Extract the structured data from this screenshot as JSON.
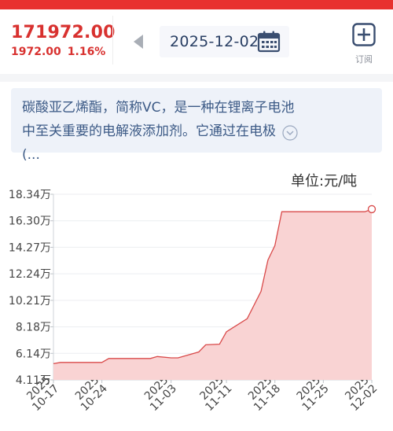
{
  "header": {
    "price": "171972.00",
    "change": "1972.00",
    "change_pct": "1.16%",
    "date": "2025-12-02",
    "subscribe_label": "订阅"
  },
  "description": {
    "text": "碳酸亚乙烯酯，简称VC，是一种在锂离子电池中至关重要的电解液添加剂。它通过在电极 (..."
  },
  "colors": {
    "up_red": "#d8312f",
    "line": "#d94a4a",
    "fill": "#f9d3d3",
    "date_text": "#283e63",
    "desc_text": "#3c5a86"
  },
  "chart_data": {
    "type": "area",
    "unit_label": "单位:元/吨",
    "y_tick_labels": [
      "18.34万",
      "16.30万",
      "14.27万",
      "12.24万",
      "10.21万",
      "8.18万",
      "6.14万",
      "4.11万"
    ],
    "ylim": [
      41100,
      183400
    ],
    "x_tick_labels": [
      [
        "2025",
        "10-17"
      ],
      [
        "2025",
        "10-24"
      ],
      [
        "2025",
        "11-03"
      ],
      [
        "2025",
        "11-11"
      ],
      [
        "2025",
        "11-18"
      ],
      [
        "2025",
        "11-25"
      ],
      [
        "2025",
        "12-02"
      ]
    ],
    "x": [
      "10-17",
      "10-18",
      "10-20",
      "10-24",
      "10-25",
      "10-26",
      "10-28",
      "10-31",
      "11-01",
      "11-03",
      "11-04",
      "11-07",
      "11-08",
      "11-10",
      "11-11",
      "11-14",
      "11-16",
      "11-17",
      "11-18",
      "11-19",
      "11-21",
      "11-24",
      "11-25",
      "11-28",
      "12-01",
      "12-02"
    ],
    "values": [
      53500,
      54500,
      54500,
      54500,
      57500,
      57500,
      57500,
      57500,
      59000,
      58000,
      58000,
      62500,
      68000,
      68500,
      78000,
      88000,
      109000,
      133000,
      144000,
      170000,
      170000,
      170000,
      170000,
      170000,
      170000,
      171972
    ],
    "grid": true,
    "legend": "none"
  }
}
